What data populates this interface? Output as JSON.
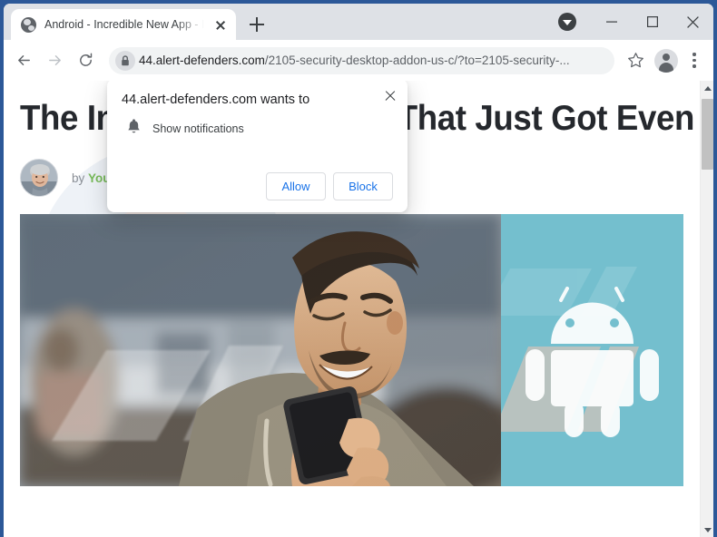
{
  "browser": {
    "tab": {
      "title": "Android - Incredible New App - I",
      "favicon": "globe-icon",
      "close_icon": "close-icon"
    },
    "new_tab_label": "+",
    "window_controls": {
      "download_icon": "download-chevron-icon",
      "minimize": "minimize-icon",
      "maximize": "maximize-icon",
      "close": "close-icon"
    },
    "toolbar": {
      "back_icon": "back-arrow-icon",
      "forward_icon": "forward-arrow-icon",
      "reload_icon": "reload-icon",
      "lock_icon": "lock-icon",
      "url_host": "44.alert-defenders.com",
      "url_path": "/2105-security-desktop-addon-us-c/?to=2105-security-...",
      "bookmark_icon": "star-icon",
      "profile_icon": "avatar-icon",
      "menu_icon": "three-dot-menu-icon"
    },
    "frame_color": "#2c5898",
    "tabstrip_color": "#dee1e6"
  },
  "permission_dialog": {
    "title": "44.alert-defenders.com wants to",
    "permission_icon": "bell-icon",
    "permission_label": "Show notifications",
    "allow_label": "Allow",
    "block_label": "Block",
    "close_icon": "close-icon",
    "link_color": "#1a73e8"
  },
  "page": {
    "headline": "The Incredible New App That Just Got Even Better – All You Need To Know.",
    "byline_prefix": "by",
    "byline_author": "Your Lifestyle",
    "byline_author_color": "#78bb5b",
    "author_avatar": "author-photo",
    "hero_photo_alt": "smiling-man-with-phone-photo",
    "android_logo": "android-robot-icon",
    "android_panel_color": "#74bfce",
    "headline_color": "#25282d"
  },
  "scrollbar": {
    "up_icon": "scroll-up-arrow-icon",
    "down_icon": "scroll-down-arrow-icon",
    "thumb": "scroll-thumb"
  }
}
